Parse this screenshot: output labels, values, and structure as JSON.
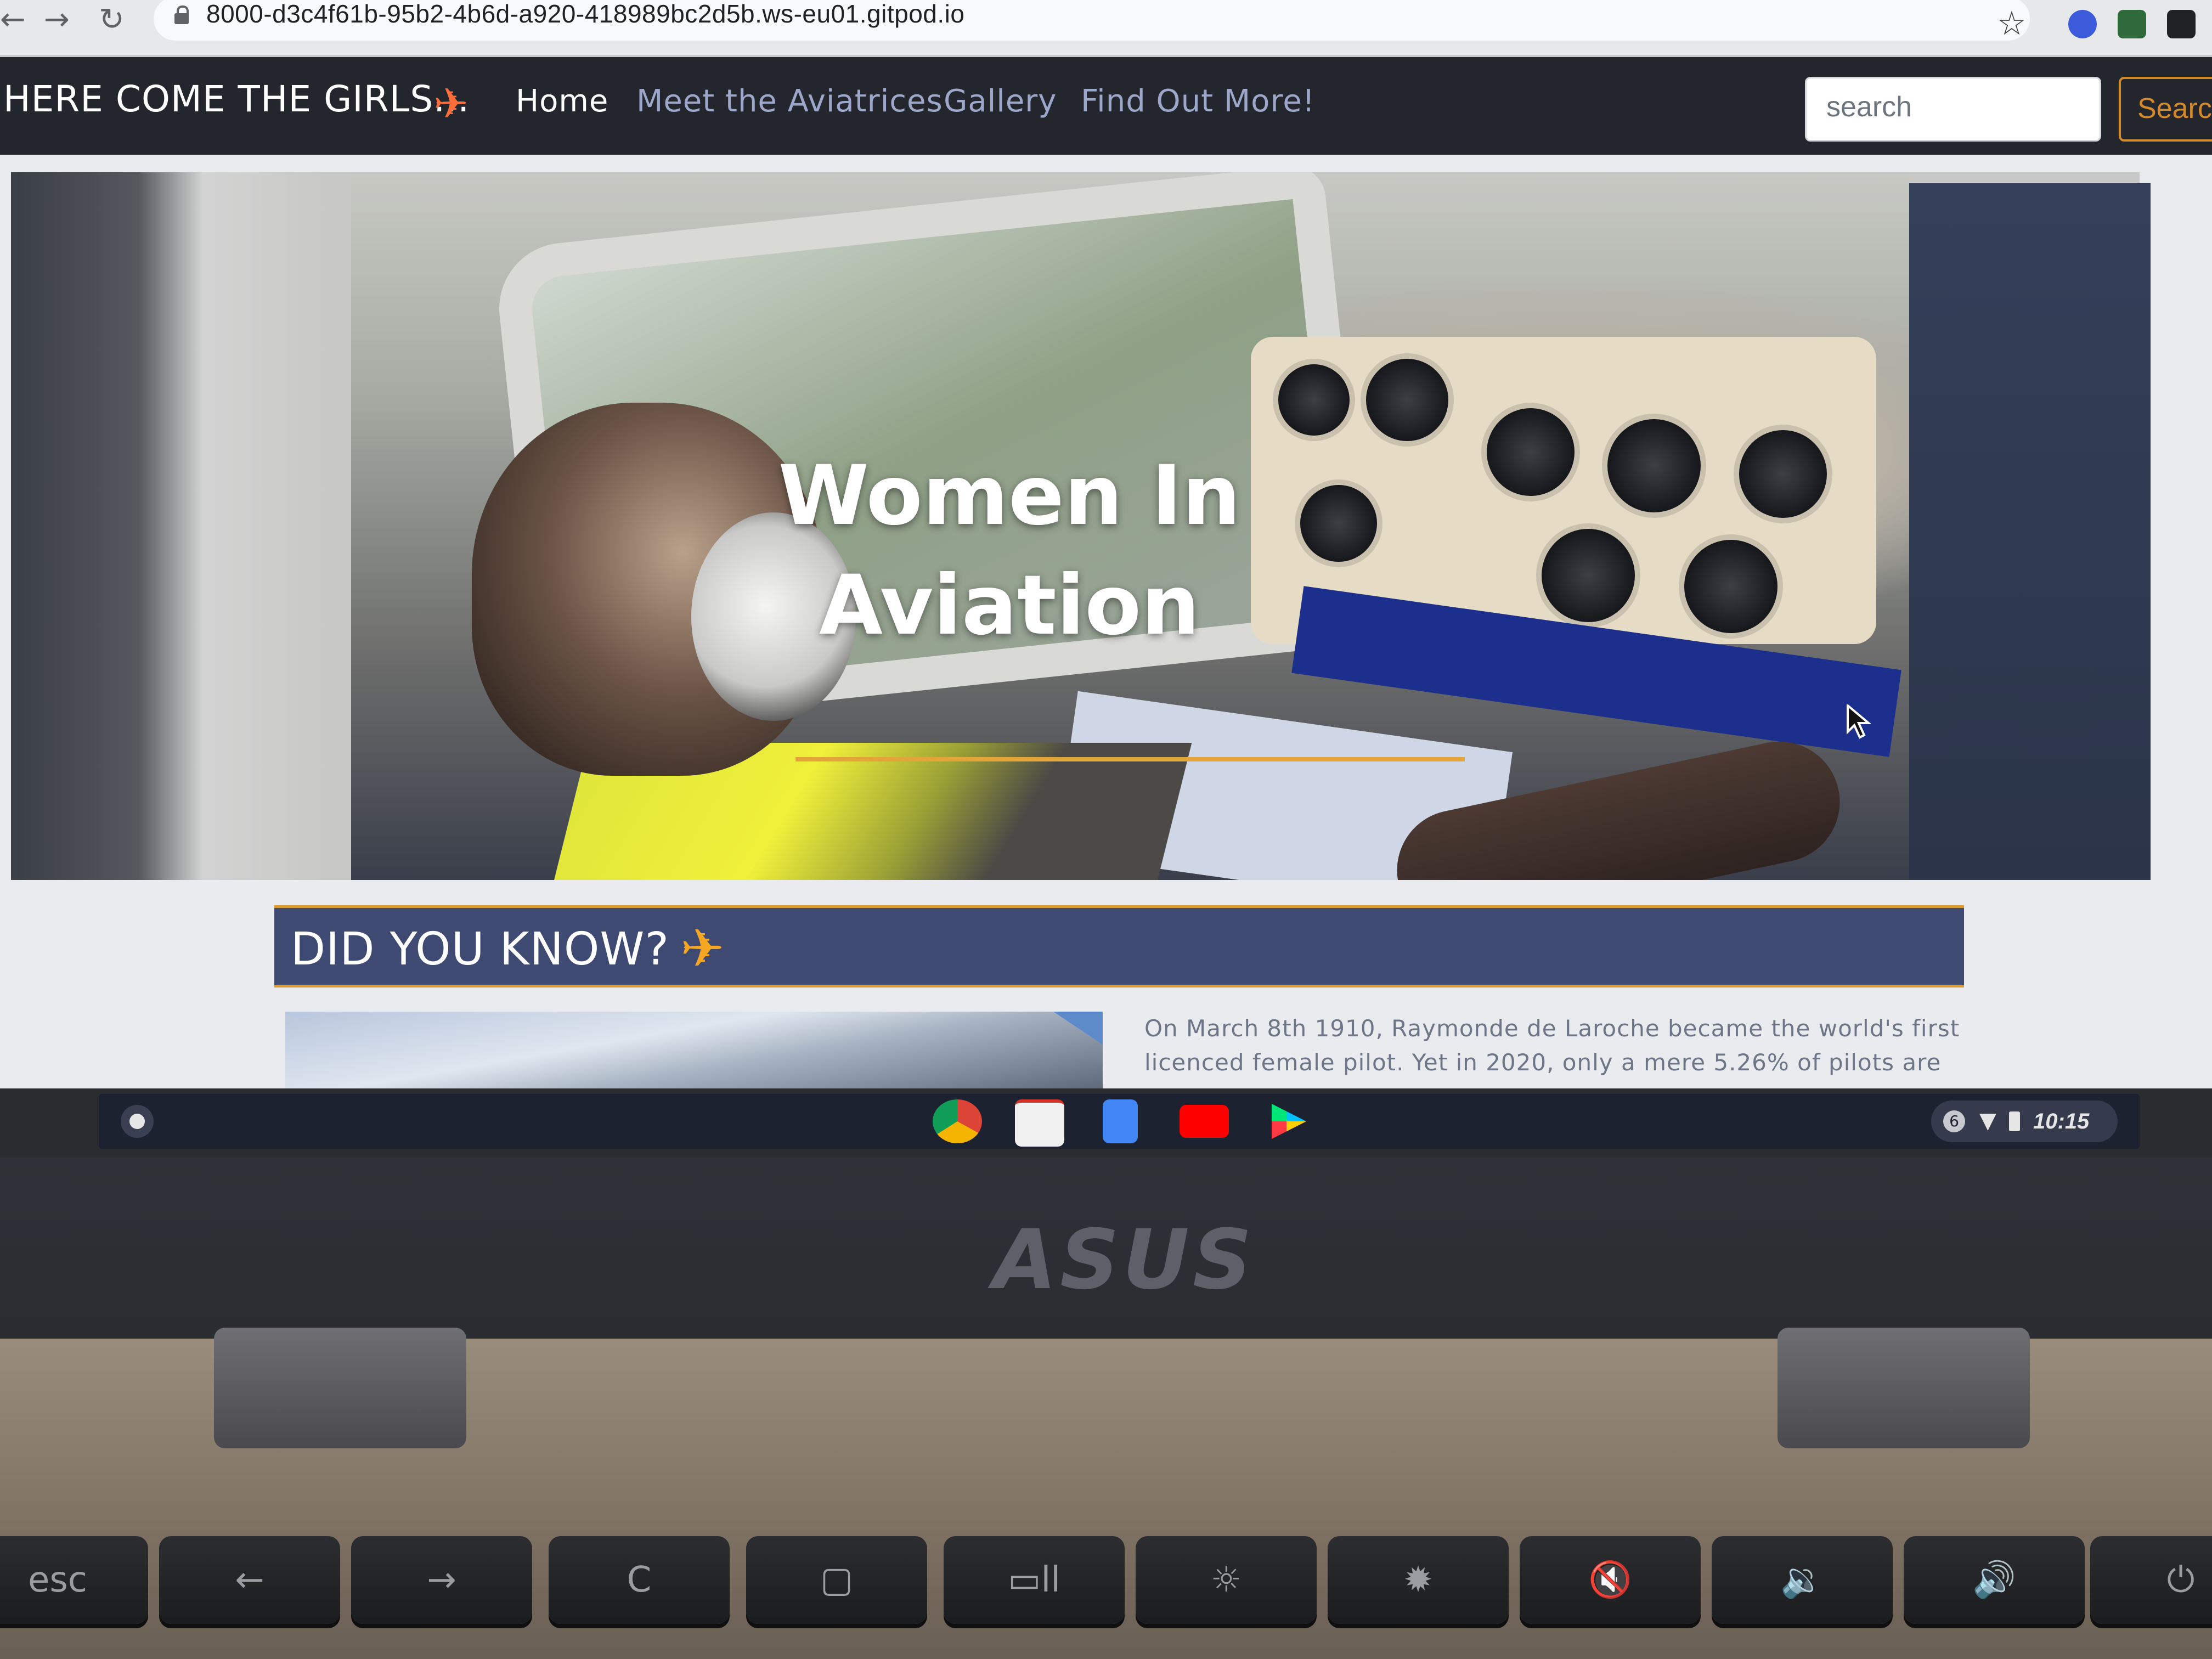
{
  "browser": {
    "url": "8000-d3c4f61b-95b2-4b6d-a920-418989bc2d5b.ws-eu01.gitpod.io",
    "back_icon": "arrow-left-icon",
    "forward_icon": "arrow-right-icon",
    "reload_icon": "reload-icon",
    "bookmark_icon": "star-icon"
  },
  "site": {
    "brand": "HERE COME THE GIRLS...",
    "brand_icon": "airplane-icon",
    "nav": [
      {
        "label": "Home",
        "active": true
      },
      {
        "label": "Meet the Aviatrices",
        "active": false
      },
      {
        "label": "Gallery",
        "active": false
      },
      {
        "label": "Find Out More!",
        "active": false
      }
    ],
    "search": {
      "placeholder": "search",
      "button_label": "Searc"
    },
    "hero": {
      "title_line1": "Women In",
      "title_line2": "Aviation"
    },
    "did_you_know": {
      "title": "DID YOU KNOW?",
      "fact_line1": "On March 8th 1910, Raymonde de Laroche became the world's first",
      "fact_line2": "licenced female pilot. Yet in 2020, only a mere 5.26% of pilots are"
    },
    "colors": {
      "nav_bg": "#23262c",
      "accent": "#e3a43a",
      "brand_plane": "#ff6d3a",
      "dyk_bg": "#3f4a73"
    }
  },
  "shelf": {
    "apps": [
      "chrome-icon",
      "gmail-icon",
      "docs-icon",
      "youtube-icon",
      "play-store-icon"
    ],
    "notification_count": "6",
    "time": "10:15"
  },
  "hardware": {
    "logo": "ASUS",
    "keys": [
      "esc",
      "←",
      "→",
      "C",
      "▢",
      "▭ll",
      "☼",
      "✹",
      "🔇",
      "🔉",
      "🔊",
      "⏻"
    ]
  }
}
